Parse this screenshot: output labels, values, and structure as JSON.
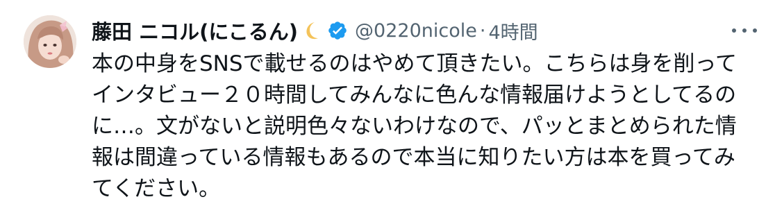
{
  "author": {
    "display_name": "藤田 ニコル(にこるん)",
    "handle": "@0220nicole",
    "separator": "·",
    "time": "4時間",
    "verified_color": "#1d9bf0",
    "moon_color": "#f4c35a"
  },
  "tweet": {
    "text": "本の中身をSNSで載せるのはやめて頂きたい。こちらは身を削って\nインタビュー２０時間してみんなに色んな情報届けようとしてるの\nに…。文がないと説明色々ないわけなので、パッとまとめられた情\n報は間違っている情報もあるので本当に知りたい方は本を買ってみ\nてください。"
  },
  "icons": {
    "avatar": "profile-photo",
    "moon": "crescent-moon-emoji",
    "verified": "verified-badge-icon",
    "more": "more-options-icon"
  }
}
